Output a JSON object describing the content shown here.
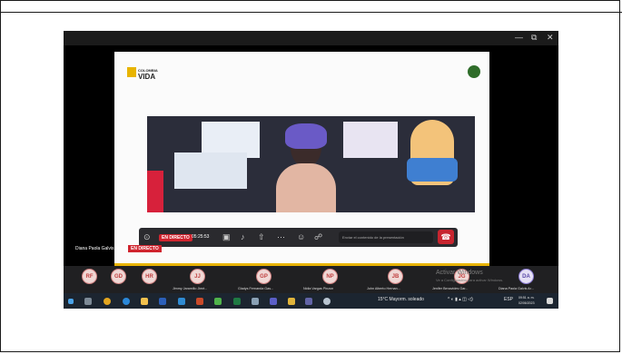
{
  "window": {
    "minimize_glyph": "—",
    "maximize_glyph": "⧉",
    "close_glyph": "✕"
  },
  "slide": {
    "logo_small": "COLOMBIA",
    "logo_main": "VIDA"
  },
  "toolbar": {
    "live_label": "EN DIRECTO",
    "timer": "05:25:53",
    "chat_placeholder": "Enviar el contenido de la presentación"
  },
  "presenter": {
    "name": "Diana Paola Galvis Ardila",
    "live_label": "EN DIRECTO"
  },
  "participants": [
    {
      "initials": "RF",
      "name": ""
    },
    {
      "initials": "GD",
      "name": ""
    },
    {
      "initials": "HR",
      "name": ""
    },
    {
      "initials": "JJ",
      "name": "Jimmy Jaramillo Jimé..."
    },
    {
      "initials": "GP",
      "name": "Gladys Fernanda Gas..."
    },
    {
      "initials": "NP",
      "name": "Nidia Vargas Pinzon"
    },
    {
      "initials": "JB",
      "name": "John Alberto Hernan..."
    },
    {
      "initials": "JG",
      "name": "Jenifer Benavides Gar..."
    },
    {
      "initials": "DA",
      "name": "Diana Paola Galvis Ar..."
    }
  ],
  "watermark": {
    "title": "Activar Windows",
    "subtitle": "Ve a Configuración para activar Windows."
  },
  "taskbar": {
    "weather": "15°C  Mayorm. soleado",
    "language": "ESP",
    "time": "09:51 a. m.",
    "date": "02/06/2023"
  },
  "colors": {
    "live_red": "#d0242e",
    "accent_yellow": "#e8b400",
    "taskbar": "#1c2530"
  }
}
